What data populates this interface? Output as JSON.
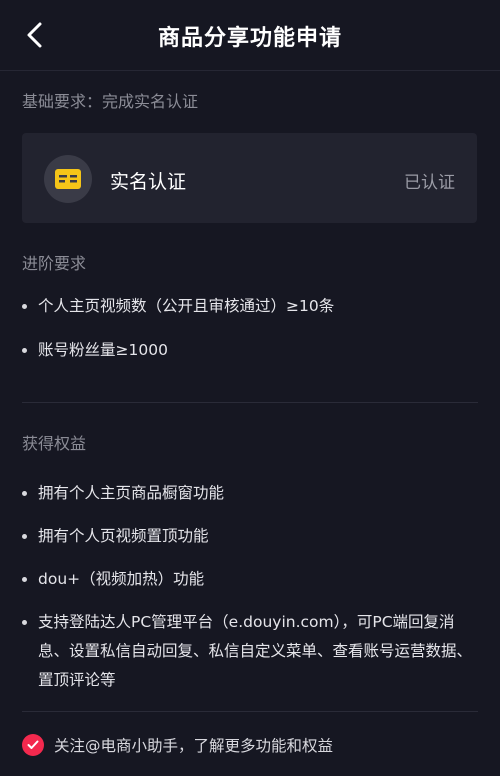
{
  "header": {
    "title": "商品分享功能申请",
    "back_icon": "chevron-left-icon"
  },
  "basic": {
    "label": "基础要求：完成实名认证",
    "card": {
      "icon": "id-card-icon",
      "icon_color": "#f5c518",
      "title": "实名认证",
      "status": "已认证"
    }
  },
  "advanced": {
    "label": "进阶要求",
    "items": [
      "个人主页视频数（公开且审核通过）≥10条",
      "账号粉丝量≥1000"
    ]
  },
  "benefits": {
    "label": "获得权益",
    "items": [
      "拥有个人主页商品橱窗功能",
      "拥有个人页视频置顶功能",
      "dou+（视频加热）功能",
      "支持登陆达人PC管理平台（e.douyin.com），可PC端回复消息、设置私信自动回复、私信自定义菜单、查看账号运营数据、置顶评论等"
    ]
  },
  "follow": {
    "checked": true,
    "check_color": "#f3294e",
    "text": "关注@电商小助手，了解更多功能和权益"
  }
}
